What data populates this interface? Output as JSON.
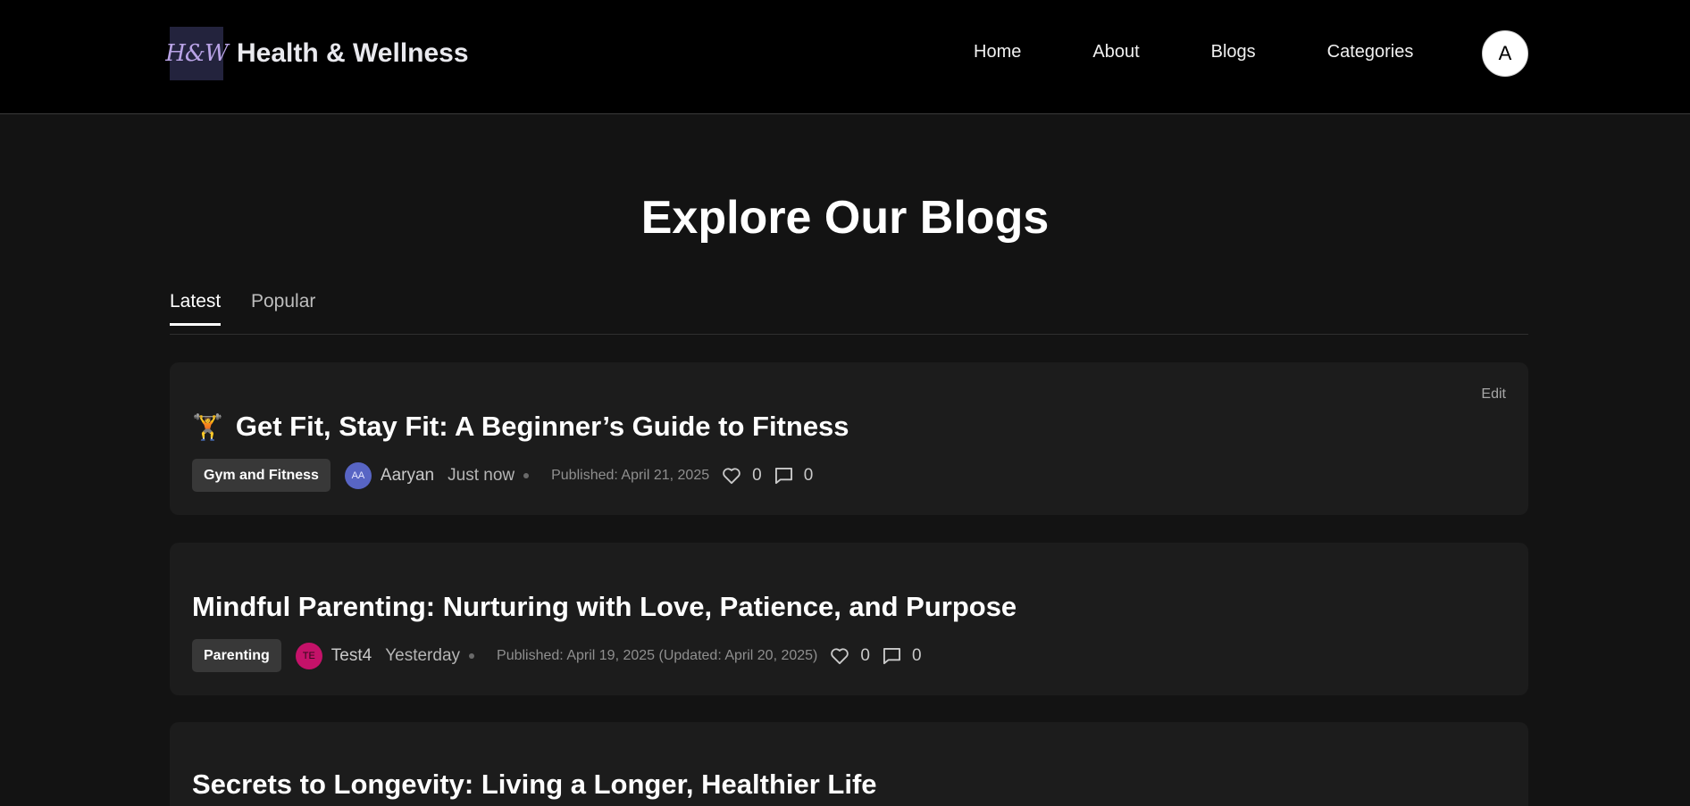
{
  "brand": {
    "logo_text": "H&W",
    "title": "Health & Wellness"
  },
  "nav": {
    "links": [
      "Home",
      "About",
      "Blogs",
      "Categories"
    ],
    "avatar_initial": "A"
  },
  "page": {
    "title": "Explore Our Blogs"
  },
  "tabs": [
    {
      "label": "Latest",
      "active": true
    },
    {
      "label": "Popular",
      "active": false
    }
  ],
  "posts": [
    {
      "emoji": "🏋️",
      "title": "Get Fit, Stay Fit: A Beginner’s Guide to Fitness",
      "edit_label": "Edit",
      "category": "Gym and Fitness",
      "author_initials": "AA",
      "author_color": "#5865c4",
      "author_text_color": "#e7e9ff",
      "author": "Aaryan",
      "time": "Just now",
      "published": "Published: April 21, 2025",
      "likes": "0",
      "comments": "0"
    },
    {
      "title": "Mindful Parenting: Nurturing with Love, Patience, and Purpose",
      "category": "Parenting",
      "author_initials": "TE",
      "author_color": "#c41269",
      "author_text_color": "#2a0a18",
      "author": "Test4",
      "time": "Yesterday",
      "published": "Published: April 19, 2025 (Updated: April 20, 2025)",
      "likes": "0",
      "comments": "0"
    },
    {
      "title": "Secrets to Longevity: Living a Longer, Healthier Life"
    }
  ],
  "icons": {
    "like": "heart-icon",
    "comment": "comment-icon"
  }
}
